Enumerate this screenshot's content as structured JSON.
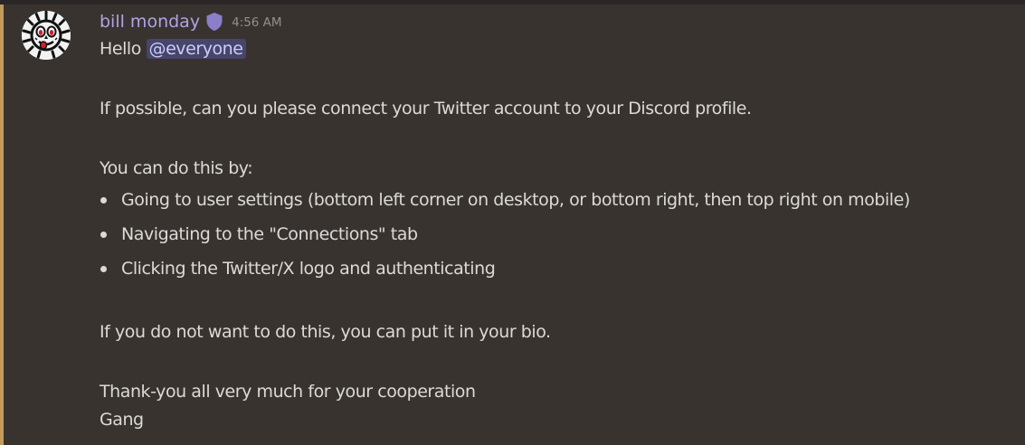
{
  "message": {
    "author": "bill monday",
    "author_color": "#b0a3e6",
    "role_icon": "shield-icon",
    "timestamp": "4:56 AM",
    "greeting": "Hello",
    "mention": "@everyone",
    "paragraph_1": "If possible, can you please connect your Twitter account to your Discord profile.",
    "paragraph_2": "You can do this by:",
    "steps": [
      "Going to user settings (bottom left corner on desktop, or bottom right, then top right on mobile)",
      "Navigating to the \"Connections\" tab",
      "Clicking the Twitter/X logo and authenticating"
    ],
    "paragraph_3": "If you do not want to do this, you can put it in your bio.",
    "closing_1": "Thank-you all very much for your cooperation",
    "closing_2": "Gang"
  },
  "colors": {
    "background": "#38332f",
    "mention_bg": "#47456a",
    "highlight_bar": "#c39a5c"
  }
}
